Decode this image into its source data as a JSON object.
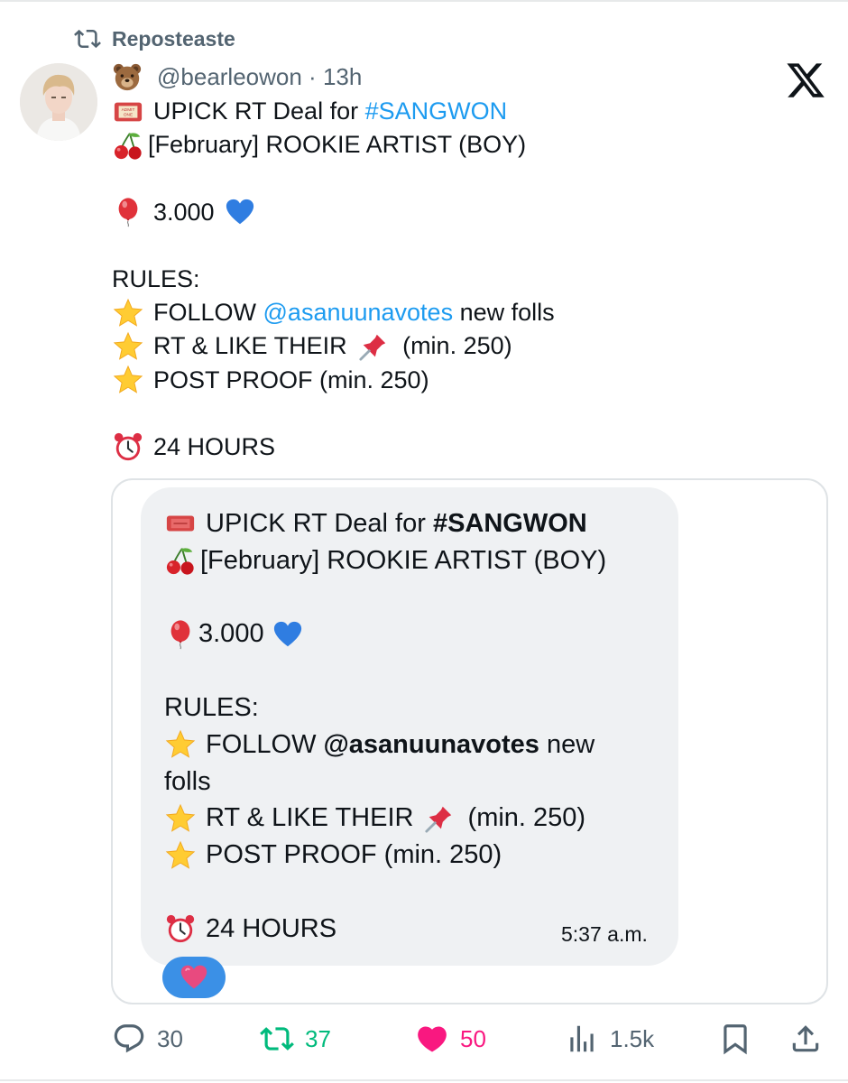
{
  "repost": {
    "label": "Reposteaste"
  },
  "post": {
    "handle": "@bearleowon",
    "separator": " · ",
    "age": "13h",
    "lines": [
      {
        "icon": "admit-one-ticket-icon",
        "parts": [
          "UPICK RT Deal for ",
          "#SANGWON"
        ]
      },
      {
        "icon": "cherries-icon",
        "parts": [
          "[February] ROOKIE ARTIST (BOY)"
        ]
      },
      {
        "icon": "red-balloon-icon",
        "parts": [
          "3.000"
        ]
      },
      {
        "parts": [
          "RULES:"
        ]
      },
      {
        "icon": "star-icon",
        "parts": [
          "FOLLOW ",
          "@asanuunavotes",
          " new folls"
        ]
      },
      {
        "icon": "star-icon",
        "parts": [
          "RT & LIKE THEIR ",
          "(min. 250)"
        ]
      },
      {
        "icon": "star-icon",
        "parts": [
          "POST PROOF (min. 250)"
        ]
      },
      {
        "icon": "alarm-clock-icon",
        "parts": [
          "24 HOURS"
        ]
      }
    ]
  },
  "quoted": {
    "lines": [
      {
        "parts": [
          "UPICK RT Deal for ",
          "#SANGWON"
        ]
      },
      {
        "parts": [
          "[February] ROOKIE ARTIST (BOY)"
        ]
      },
      {
        "parts": [
          "3.000"
        ]
      },
      {
        "parts": [
          "RULES:"
        ]
      },
      {
        "parts": [
          "FOLLOW ",
          "@asanuunavotes",
          " new"
        ]
      },
      {
        "parts": [
          "folls"
        ]
      },
      {
        "parts": [
          "RT & LIKE THEIR ",
          "(min. 250)"
        ]
      },
      {
        "parts": [
          "POST PROOF (min. 250)"
        ]
      },
      {
        "parts": [
          "24 HOURS"
        ]
      }
    ],
    "time": "5:37 a.m.",
    "reaction": "heart-icon"
  },
  "actions": {
    "replies": "30",
    "reposts": "37",
    "likes": "50",
    "views": "1.5k"
  },
  "colors": {
    "link": "#1d9bf0",
    "muted": "#536471",
    "repost_green": "#00ba7c",
    "like_pink": "#f91880",
    "bubble_bg": "#eff1f3",
    "reaction_blue": "#3b90e6"
  }
}
